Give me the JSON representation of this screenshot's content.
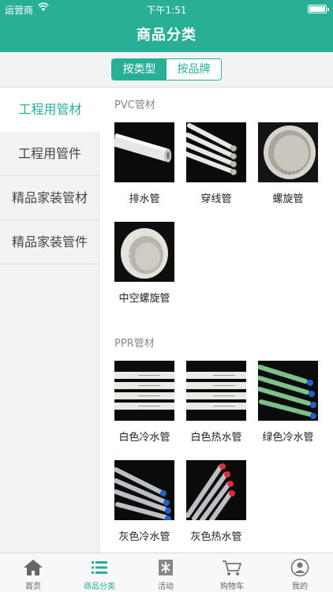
{
  "status_bar": {
    "carrier": "运营商",
    "time": "下午1:51"
  },
  "header": {
    "title": "商品分类"
  },
  "segment": {
    "by_type": "按类型",
    "by_brand": "按品牌"
  },
  "sidebar": {
    "items": [
      {
        "label": "工程用管材"
      },
      {
        "label": "工程用管件"
      },
      {
        "label": "精品家装管材"
      },
      {
        "label": "精品家装管件"
      }
    ]
  },
  "sections": [
    {
      "title": "PVC管材",
      "products": [
        {
          "label": "排水管"
        },
        {
          "label": "穿线管"
        },
        {
          "label": "螺旋管"
        },
        {
          "label": "中空螺旋管"
        }
      ]
    },
    {
      "title": "PPR管材",
      "products": [
        {
          "label": "白色冷水管"
        },
        {
          "label": "白色热水管"
        },
        {
          "label": "绿色冷水管"
        },
        {
          "label": "灰色冷水管"
        },
        {
          "label": "灰色热水管"
        }
      ]
    }
  ],
  "tabbar": {
    "items": [
      {
        "label": "首页",
        "icon": "home-icon"
      },
      {
        "label": "商品分类",
        "icon": "list-icon"
      },
      {
        "label": "活动",
        "icon": "activity-icon"
      },
      {
        "label": "购物车",
        "icon": "cart-icon"
      },
      {
        "label": "我的",
        "icon": "user-icon"
      }
    ]
  },
  "colors": {
    "accent": "#2aaf97",
    "sidebar_bg": "#f2f3f5"
  }
}
